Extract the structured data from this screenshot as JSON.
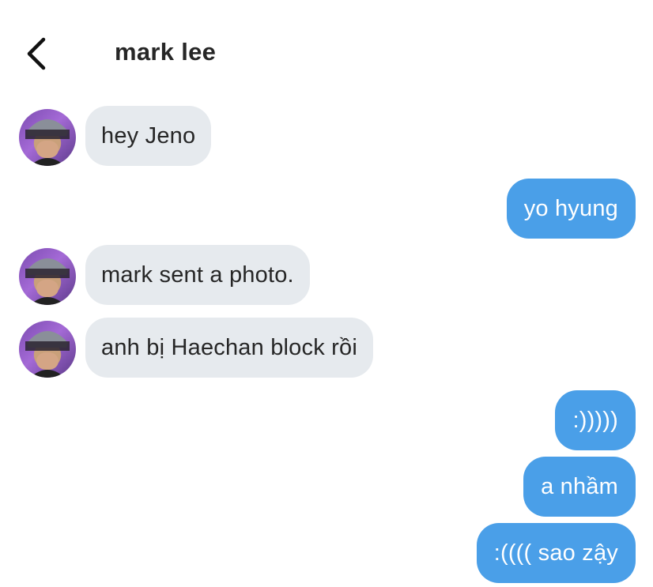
{
  "header": {
    "title": "mark lee"
  },
  "messages": [
    {
      "side": "incoming",
      "text": "hey Jeno"
    },
    {
      "side": "outgoing",
      "text": "yo hyung"
    },
    {
      "side": "incoming",
      "text": "mark sent a photo."
    },
    {
      "side": "incoming",
      "text": "anh bị Haechan block rồi"
    },
    {
      "side": "outgoing",
      "text": ":)))))"
    },
    {
      "side": "outgoing",
      "text": "a nhầm"
    },
    {
      "side": "outgoing",
      "text": ":(((( sao zậy"
    }
  ],
  "colors": {
    "incoming_bubble": "#e6eaee",
    "outgoing_bubble": "#4a9fe8",
    "title_text": "#262626"
  },
  "icons": {
    "back": "chevron-left-icon",
    "avatar": "contact-avatar"
  }
}
